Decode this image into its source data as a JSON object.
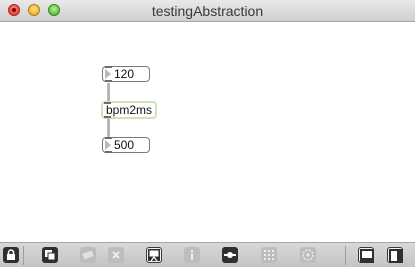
{
  "window": {
    "title": "testingAbstraction"
  },
  "patch": {
    "number_top": "120",
    "abstraction_name": "bpm2ms",
    "number_bottom": "500"
  },
  "toolbar": {
    "icons": [
      "lock-icon",
      "presentation-icon",
      "object-palette-icon",
      "clear-icon",
      "paint-icon",
      "inspector-icon",
      "inlet-outlet-icon",
      "grid-icon",
      "debug-icon",
      "sidebar-left-icon",
      "sidebar-right-icon"
    ]
  }
}
